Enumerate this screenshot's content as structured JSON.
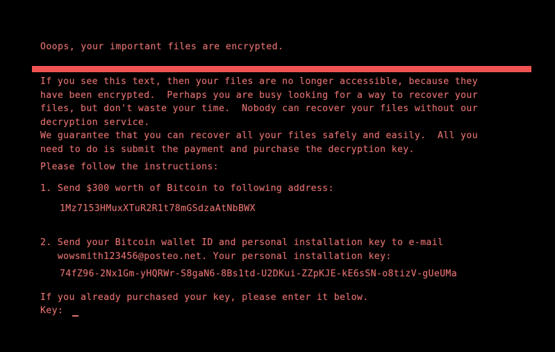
{
  "screen": {
    "background_color": "#000000",
    "text_color": "#e0706e",
    "divider_color": "#ef5452"
  },
  "title": "Ooops, your important files are encrypted.",
  "paragraphs": {
    "intro": "If you see this text, then your files are no longer accessible, because they\nhave been encrypted.  Perhaps you are busy looking for a way to recover your\nfiles, but don't waste your time.  Nobody can recover your files without our\ndecryption service.",
    "guarantee": "We guarantee that you can recover all your files safely and easily.  All you\nneed to do is submit the payment and purchase the decryption key.",
    "follow": "Please follow the instructions:"
  },
  "instructions": [
    {
      "label": "1. Send $300 worth of Bitcoin to following address:",
      "value": "1Mz7153HMuxXTuR2R1t78mGSdzaAtNbBWX"
    },
    {
      "label": "2. Send your Bitcoin wallet ID and personal installation key to e-mail\n   wowsmith123456@posteo.net. Your personal installation key:",
      "value": "74fZ96-2Nx1Gm-yHQRWr-S8gaN6-8Bs1td-U2DKui-ZZpKJE-kE6sSN-o8tizV-gUeUMa"
    }
  ],
  "footer": {
    "already_purchased": "If you already purchased your key, please enter it below.",
    "key_prompt": "Key: ",
    "key_value": ""
  }
}
